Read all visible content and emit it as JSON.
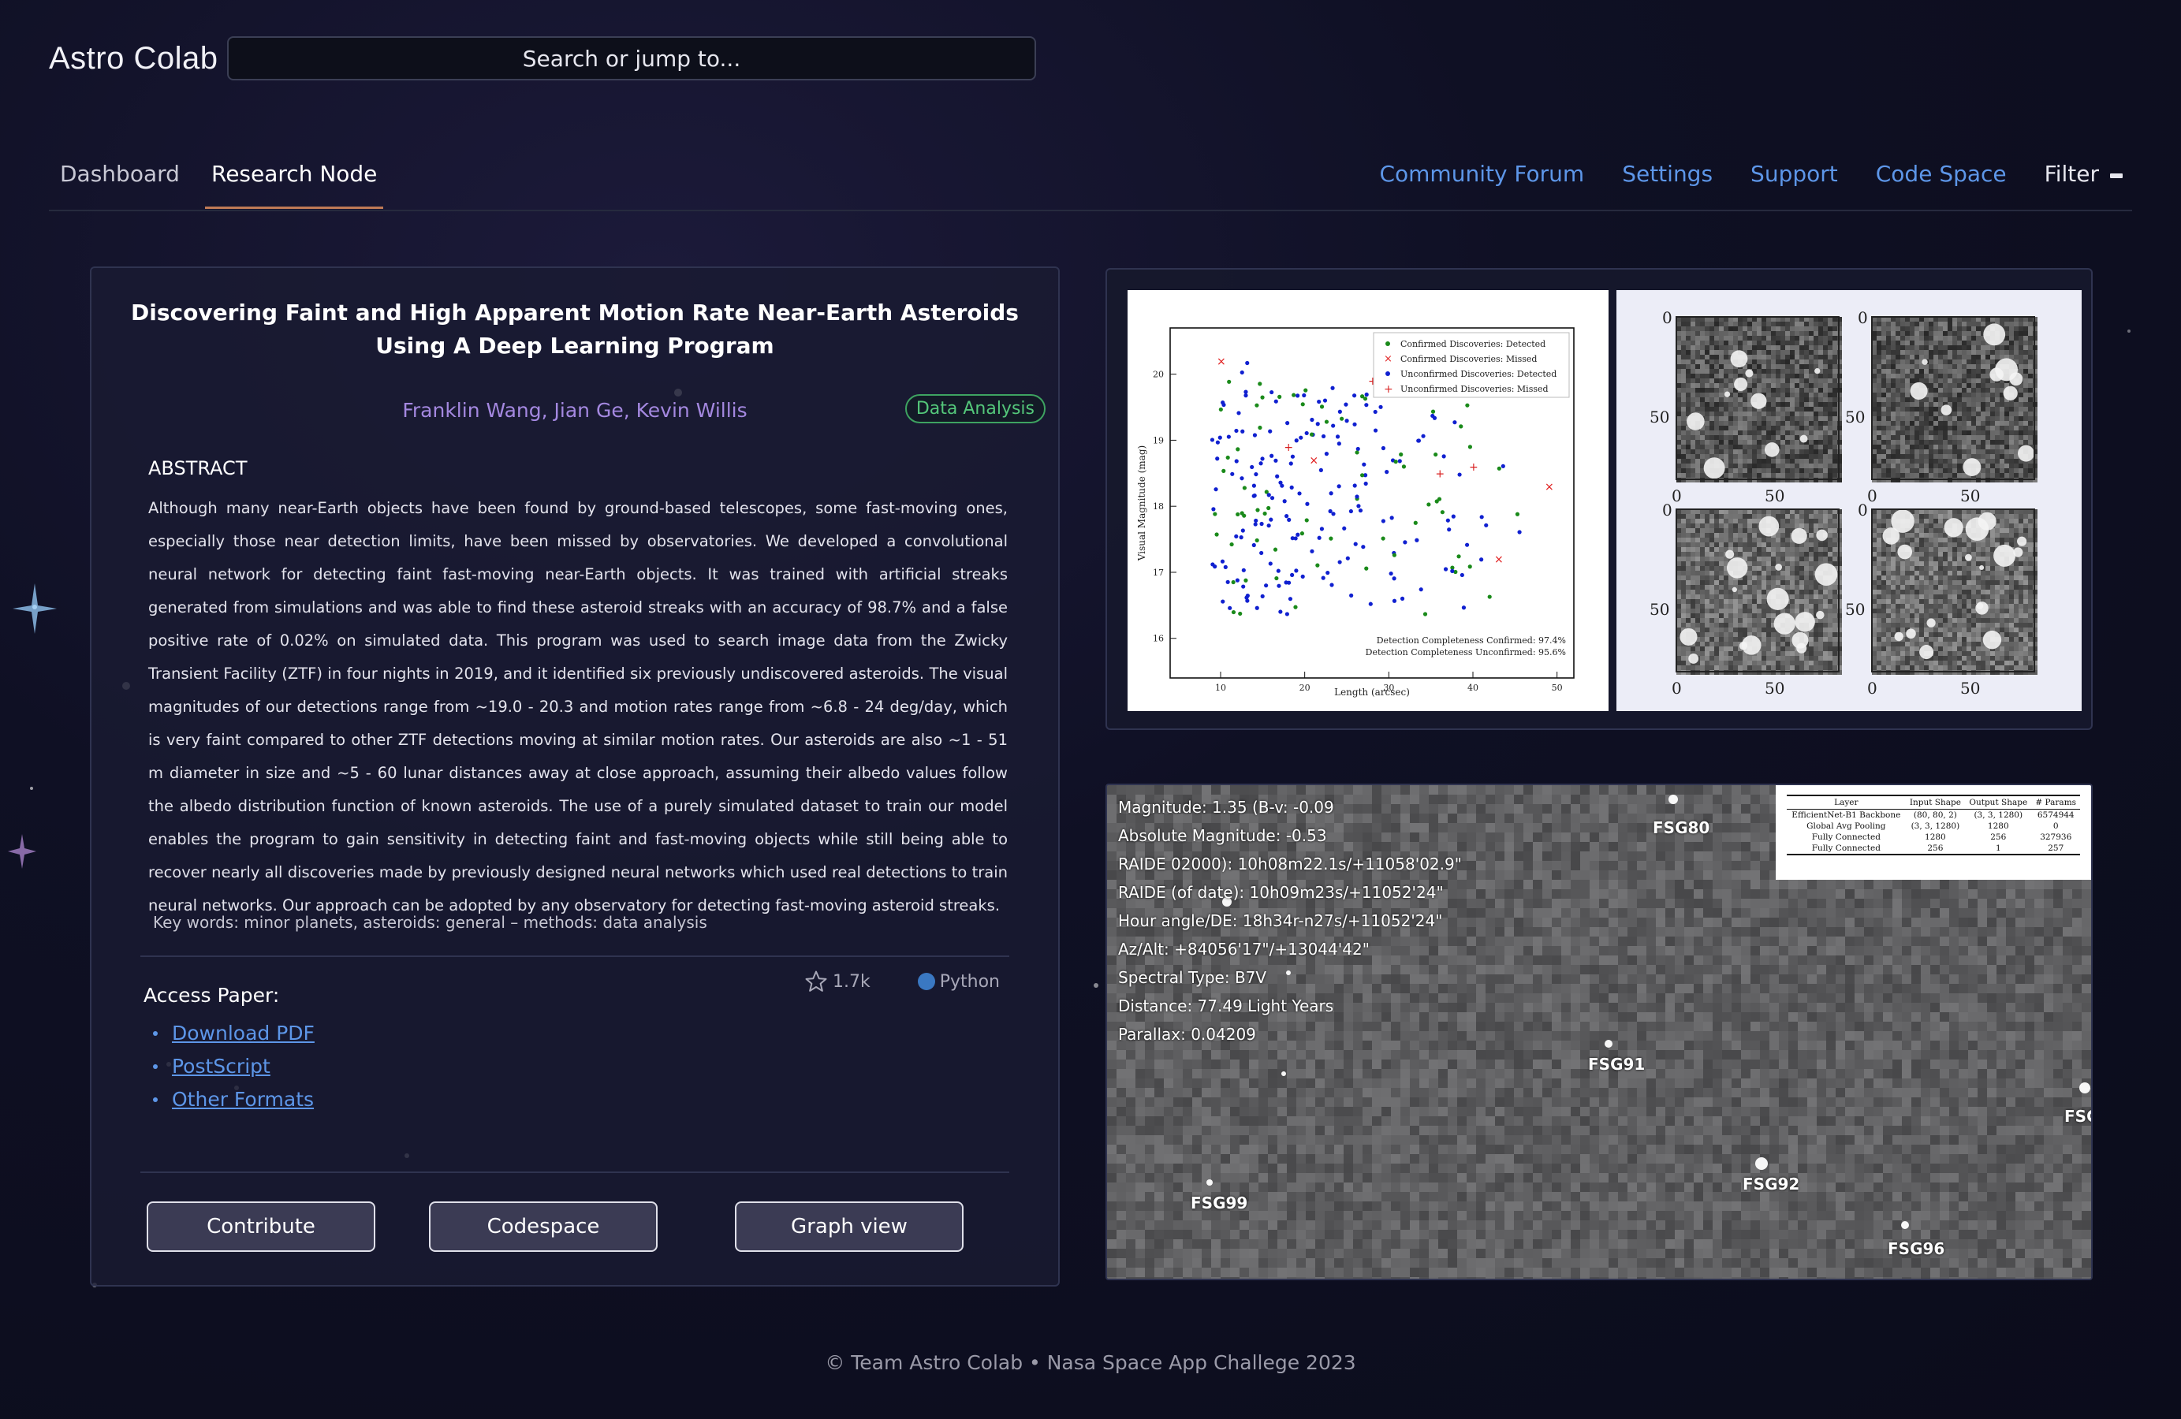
{
  "app": {
    "brand": "Astro Colab",
    "search_placeholder": "Search or jump to..."
  },
  "nav": {
    "tabs": [
      {
        "label": "Dashboard"
      },
      {
        "label": "Research Node",
        "active": true
      }
    ],
    "links": [
      "Community Forum",
      "Settings",
      "Support",
      "Code Space"
    ],
    "filter_label": "Filter"
  },
  "paper": {
    "title": "Discovering Faint and High Apparent Motion Rate Near-Earth Asteroids Using A Deep Learning Program",
    "authors": "Franklin Wang, Jian Ge, Kevin Willis",
    "badge": "Data Analysis",
    "abstract_heading": "ABSTRACT",
    "abstract": "Although many near-Earth objects have been found by ground-based telescopes, some fast-moving ones, especially those near detection limits, have been missed by observatories. We developed a convolutional neural network for detecting faint fast-moving near-Earth objects. It was trained with artificial streaks generated from simulations and was able to find these asteroid streaks with an accuracy of 98.7% and a false positive rate of 0.02% on simulated data. This program was used to search image data from the Zwicky Transient Facility (ZTF) in four nights in 2019, and it identified six previously undiscovered asteroids. The visual magnitudes of our detections range from ~19.0 - 20.3 and motion rates range from ~6.8 - 24 deg/day, which is very faint compared to other ZTF detections moving at similar motion rates. Our asteroids are also ~1 - 51 m diameter in size and ~5 - 60 lunar distances away at close approach, assuming their albedo values follow the albedo distribution function of known asteroids. The use of a purely simulated dataset to train our model enables the program to gain sensitivity in detecting faint and fast-moving objects while still being able to recover nearly all discoveries made by previously designed neural networks which used real detections to train neural networks. Our approach can be adopted by any observatory for detecting fast-moving asteroid streaks.",
    "keywords": "Key words: minor planets, asteroids: general – methods: data analysis",
    "stars": "1.7k",
    "language": "Python",
    "access_heading": "Access Paper:",
    "access_links": [
      "Download PDF",
      "PostScript",
      "Other Formats"
    ],
    "actions": [
      "Contribute",
      "Codespace",
      "Graph view"
    ]
  },
  "figure": {
    "legend": [
      "Confirmed Discoveries: Detected",
      "Confirmed Discoveries: Missed",
      "Unconfirmed Discoveries: Detected",
      "Unconfirmed Discoveries: Missed"
    ],
    "xlabel": "Length (arcsec)",
    "ylabel": "Visual Magnitude (mag)",
    "x_ticks": [
      "10",
      "20",
      "30",
      "40",
      "50"
    ],
    "y_ticks": [
      "16",
      "17",
      "18",
      "19",
      "20"
    ],
    "notes": [
      "Detection Completeness Confirmed: 97.4%",
      "Detection Completeness Unconfirmed: 95.6%"
    ],
    "series_colors": {
      "confirmed_detected": "#1a8a1a",
      "confirmed_missed": "#e01b1b",
      "unconfirmed_detected": "#1020d0",
      "unconfirmed_missed": "#d82020"
    },
    "cutout_ticks": [
      "0",
      "50"
    ]
  },
  "map": {
    "info": [
      "Magnitude: 1.35 (B-v: -0.09",
      "Absolute Magnitude: -0.53",
      "RAIDE 02000): 10h08m22.1s/+11058'02.9\"",
      "RAIDE (of date): 10h09m23s/+11052'24\"",
      "Hour angle/DE: 18h34r-n27s/+11052'24\"",
      "Az/Alt: +84056'17\"/+13044'42\"",
      "Spectral Type: B7V",
      "Distance: 77.49 Light Years",
      "Parallax: 0.04209"
    ],
    "labels": [
      "FSG80",
      "FSG91",
      "FSG",
      "FSG92",
      "FSG99",
      "FSG96"
    ],
    "table": {
      "headers": [
        "Layer",
        "Input Shape",
        "Output Shape",
        "# Params"
      ],
      "rows": [
        [
          "EfficientNet-B1 Backbone",
          "(80, 80, 2)",
          "(3, 3, 1280)",
          "6574944"
        ],
        [
          "Global Avg Pooling",
          "(3, 3, 1280)",
          "1280",
          "0"
        ],
        [
          "Fully Connected",
          "1280",
          "256",
          "327936"
        ],
        [
          "Fully Connected",
          "256",
          "1",
          "257"
        ]
      ]
    }
  },
  "footer": "© Team Astro Colab • Nasa Space App Challege 2023"
}
